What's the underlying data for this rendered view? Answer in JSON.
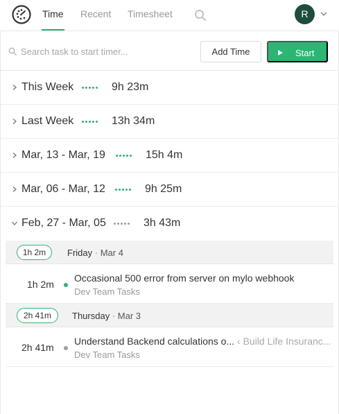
{
  "nav": {
    "tabs": [
      {
        "label": "Time",
        "active": true
      },
      {
        "label": "Recent",
        "active": false
      },
      {
        "label": "Timesheet",
        "active": false
      }
    ],
    "avatar_initial": "R"
  },
  "timer": {
    "search_placeholder": "Search task to start timer...",
    "add_time_label": "Add Time",
    "start_label": "Start"
  },
  "weeks": [
    {
      "title": "This Week",
      "total": "9h 23m",
      "expanded": false,
      "dot_color": "#2bb673"
    },
    {
      "title": "Last Week",
      "total": "13h 34m",
      "expanded": false,
      "dot_color": "#2bb673"
    },
    {
      "title": "Mar, 13 - Mar, 19",
      "total": "15h 4m",
      "expanded": false,
      "dot_color": "#2bb673"
    },
    {
      "title": "Mar, 06 - Mar, 12",
      "total": "9h 25m",
      "expanded": false,
      "dot_color": "#2bb673"
    },
    {
      "title": "Feb, 27 - Mar, 05",
      "total": "3h 43m",
      "expanded": true,
      "dot_color": "#9e9e9e"
    }
  ],
  "days": [
    {
      "total": "1h 2m",
      "day": "Friday",
      "separator": "·",
      "date": "Mar 4",
      "entries": [
        {
          "duration": "1h 2m",
          "task": "Occasional 500 error from server on mylo webhook",
          "breadcrumb": "",
          "project": "Dev Team Tasks",
          "dot_color": "#2bb673"
        }
      ]
    },
    {
      "total": "2h 41m",
      "day": "Thursday",
      "separator": "·",
      "date": "Mar 3",
      "entries": [
        {
          "duration": "2h 41m",
          "task": "Understand Backend calculations o...",
          "breadcrumb": "‹ Build Life Insuranc...",
          "project": "Dev Team Tasks",
          "dot_color": "#9e9e9e"
        }
      ]
    }
  ],
  "colors": {
    "accent": "#2bb673",
    "avatar_bg": "#1f4d3d",
    "muted_dot": "#9e9e9e"
  },
  "icons": {
    "logo": "clock-logo-icon",
    "nav_search": "search-icon",
    "avatar_menu": "chevron-down-icon",
    "week_collapsed": "chevron-right-icon",
    "week_expanded": "chevron-down-icon",
    "play": "play-icon"
  }
}
